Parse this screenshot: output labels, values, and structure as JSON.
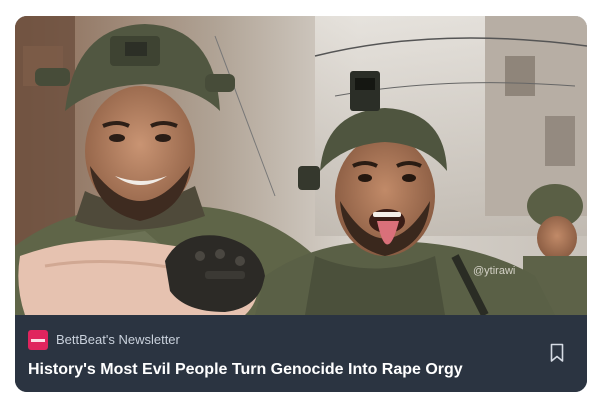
{
  "post": {
    "publication_name": "BettBeat's Newsletter",
    "title": "History's Most Evil People Turn Genocide Into Rape Orgy",
    "image_watermark": "@ytirawi"
  },
  "colors": {
    "card_background": "#2b3441",
    "publication_logo": "#e0245e",
    "title_text": "#ffffff",
    "publication_text": "#c9d1dc"
  },
  "icons": {
    "bookmark": "bookmark-icon",
    "publication_logo": "publication-logo"
  }
}
